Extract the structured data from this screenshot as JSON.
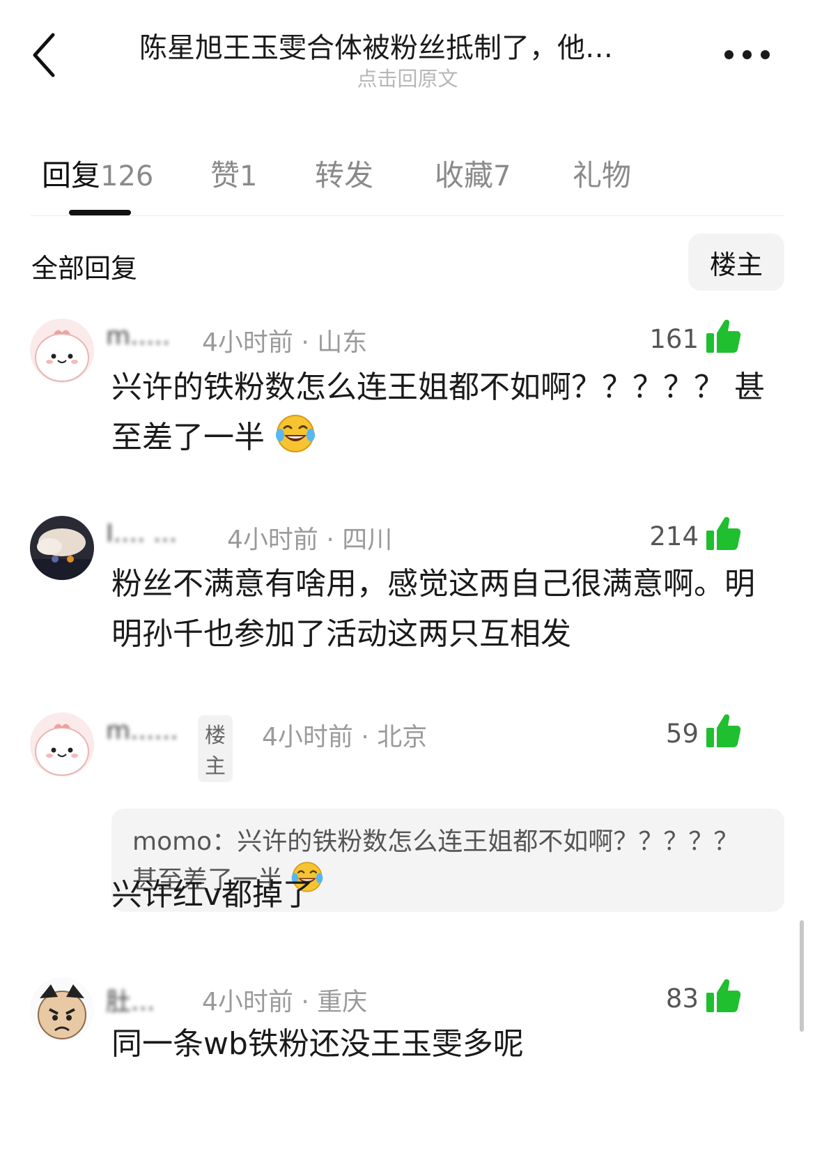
{
  "header": {
    "title": "陈星旭王玉雯合体被粉丝抵制了，他…",
    "subtitle": "点击回原文",
    "back_icon": "chevron-left-icon",
    "more_icon": "more-dots-icon"
  },
  "tabs": [
    {
      "label": "回复",
      "count": "126",
      "active": true
    },
    {
      "label": "赞",
      "count": "1",
      "active": false
    },
    {
      "label": "转发",
      "count": "",
      "active": false
    },
    {
      "label": "收藏",
      "count": "7",
      "active": false
    },
    {
      "label": "礼物",
      "count": "",
      "active": false
    }
  ],
  "section": {
    "title": "全部回复",
    "filter_label": "楼主"
  },
  "colors": {
    "like_green": "#1fbf2f",
    "text_primary": "#1a1a1a",
    "text_secondary": "#9a9a9a",
    "quote_bg": "#f4f4f4"
  },
  "comments": [
    {
      "user": "m.....",
      "time_location": "4小时前 · 山东",
      "likes": "161",
      "text": "兴许的铁粉数怎么连王姐都不如啊？？？？？ 甚至差了一半",
      "emoji": "laughing-tears-emoji"
    },
    {
      "user": "I.... ...",
      "time_location": "4小时前 · 四川",
      "likes": "214",
      "text": "粉丝不满意有啥用，感觉这两自己很满意啊。明明孙千也参加了活动这两只互相发"
    },
    {
      "user": "m......",
      "op_badge": "楼主",
      "time_location": "4小时前 · 北京",
      "likes": "59",
      "quote_author": "momo：",
      "quote_text": "兴许的铁粉数怎么连王姐都不如啊？？？？？ 甚至差了一半",
      "text": "兴许红v都掉了"
    },
    {
      "user": "肚...",
      "time_location": "4小时前 · 重庆",
      "likes": "83",
      "text": "同一条wb铁粉还没王玉雯多呢"
    }
  ]
}
